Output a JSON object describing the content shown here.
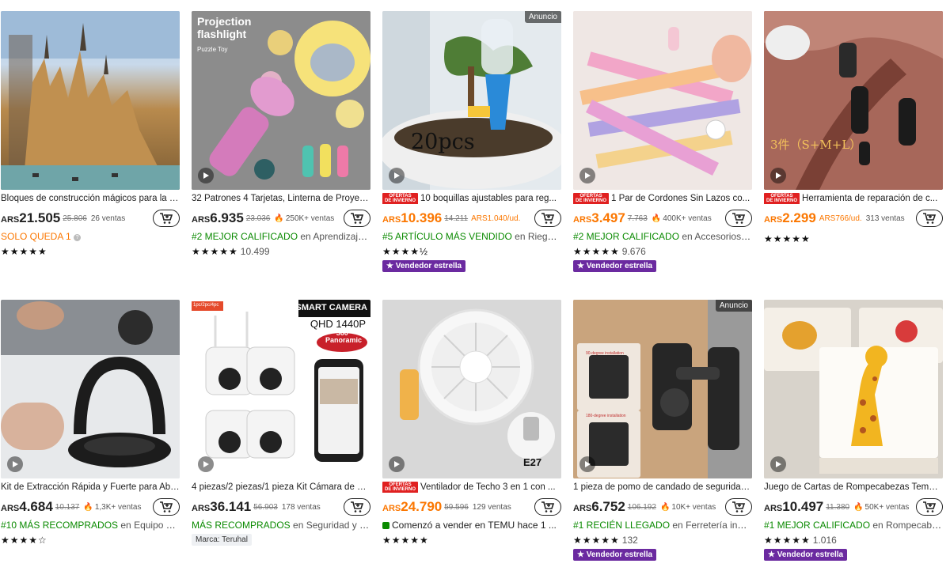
{
  "cards": [
    {
      "title": "Bloques de construcción mágicos para la e...",
      "currency": "ARS",
      "price": "21.505",
      "old_price": "25.806",
      "sales": "26 ventas",
      "tag_highlight": "SOLO QUEDA 1",
      "tag_rest": "",
      "stars": "★★★★★",
      "rating_count": ""
    },
    {
      "title": "32 Patrones 4 Tarjetas, Linterna de Proyecci...",
      "currency": "ARS",
      "price": "6.935",
      "old_price": "23.036",
      "sales": "250K+ ventas",
      "tag_highlight": "#2 MEJOR CALIFICADO",
      "tag_rest": " en Aprendizaje ...",
      "stars": "★★★★★",
      "rating_count": "10.499",
      "image_text_1": "Projection",
      "image_text_2": "flashlight",
      "image_text_3": "Puzzle Toy"
    },
    {
      "ad_label": "Anuncio",
      "winter_label_1": "OFERTAS",
      "winter_label_2": "DE INVIERNO",
      "title": "10 boquillas ajustables para reg...",
      "currency": "ARS",
      "price": "10.396",
      "old_price": "14.211",
      "unit_price": "ARS1.040/ud.",
      "tag_highlight": "#5 ARTÍCULO MÁS VENDIDO",
      "tag_rest": " en Riego ...",
      "stars": "★★★★½",
      "badge": "Vendedor estrella",
      "image_text_1": "20pcs"
    },
    {
      "winter_label_1": "OFERTAS",
      "winter_label_2": "DE INVIERNO",
      "title": "1 Par de Cordones Sin Lazos co...",
      "currency": "ARS",
      "price": "3.497",
      "old_price": "7.763",
      "sales": "400K+ ventas",
      "tag_highlight": "#2 MEJOR CALIFICADO",
      "tag_rest": " en Accesorios p...",
      "stars": "★★★★★",
      "rating_count": "9.676",
      "badge": "Vendedor estrella"
    },
    {
      "winter_label_1": "OFERTAS",
      "winter_label_2": "DE INVIERNO",
      "title": "Herramienta de reparación de c...",
      "currency": "ARS",
      "price": "2.299",
      "unit_price": "ARS766/ud.",
      "sales": "313 ventas",
      "stars": "★★★★★",
      "image_text_1": "3件（S+M+L）"
    },
    {
      "title": "Kit de Extracción Rápida y Fuerte para Abo...",
      "currency": "ARS",
      "price": "4.684",
      "old_price": "10.137",
      "sales": "1,3K+ ventas",
      "tag_highlight": "#10 MÁS RECOMPRADOS",
      "tag_rest": " en Equipo de...",
      "stars": "★★★★☆"
    },
    {
      "title": "4 piezas/2 piezas/1 pieza Kit Cámara de se...",
      "currency": "ARS",
      "price": "36.141",
      "old_price": "56.903",
      "sales": "178 ventas",
      "tag_highlight": "MÁS RECOMPRADOS",
      "tag_rest": " en Seguridad y vi...",
      "brand": "Marca: Teruhal",
      "image_text_1": "SMART CAMERA",
      "image_text_2": "QHD 1440P",
      "image_text_3": "360°",
      "image_text_4": "Panoramic",
      "image_text_5": "1pc/2pc/4pc"
    },
    {
      "winter_label_1": "OFERTAS",
      "winter_label_2": "DE INVIERNO",
      "title": "Ventilador de Techo 3 en 1 con ...",
      "currency": "ARS",
      "price": "24.790",
      "old_price": "59.596",
      "sales": "129 ventas",
      "tag_rest": "Comenzó a vender en TEMU hace 1 ...",
      "stars": "★★★★★",
      "image_text_1": "E27"
    },
    {
      "ad_label": "Anuncio",
      "title": "1 pieza de pomo de candado de seguridad...",
      "currency": "ARS",
      "price": "6.752",
      "old_price": "106.192",
      "sales": "10K+ ventas",
      "tag_highlight": "#1 RECIÉN LLEGADO",
      "tag_rest": " en Ferretería indu...",
      "stars": "★★★★★",
      "rating_count": "132",
      "badge": "Vendedor estrella",
      "image_text_1": "90-degree installation",
      "image_text_2": "180-degree installation"
    },
    {
      "title": "Juego de Cartas de Rompecabezas Temátic...",
      "currency": "ARS",
      "price": "10.497",
      "old_price": "11.380",
      "sales": "50K+ ventas",
      "tag_highlight": "#1 MEJOR CALIFICADO",
      "tag_rest": " en Rompecabez...",
      "stars": "★★★★★",
      "rating_count": "1.016",
      "badge": "Vendedor estrella"
    }
  ]
}
